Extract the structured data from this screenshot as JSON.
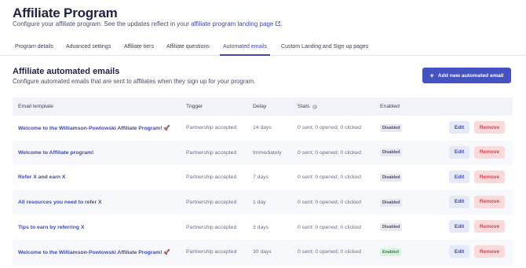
{
  "header": {
    "title": "Affiliate Program",
    "subtitle_prefix": "Configure your affiliate program. See the updates reflect in your ",
    "subtitle_link": "affiliate program landing page",
    "subtitle_suffix": "."
  },
  "tabs": [
    {
      "label": "Program details",
      "active": false
    },
    {
      "label": "Advanced settings",
      "active": false
    },
    {
      "label": "Affiliate tiers",
      "active": false
    },
    {
      "label": "Affiliate questions",
      "active": false
    },
    {
      "label": "Automated emails",
      "active": true
    },
    {
      "label": "Custom Landing and Sign up pages",
      "active": false
    }
  ],
  "section": {
    "title": "Affiliate automated emails",
    "subtitle": "Configure automated emails that are sent to affiliates when they sign up for your program.",
    "add_button_label": "Add new automated email"
  },
  "table": {
    "columns": {
      "template": "Email template",
      "trigger": "Trigger",
      "delay": "Delay",
      "stats": "Stats",
      "enabled": "Enabled"
    },
    "rows": [
      {
        "template": "Welcome to the Williamson-Powlowski Affiliate Program! 🚀",
        "trigger": "Partnership accepted",
        "delay": "14 days",
        "stats": "0 sent; 0 opened; 0 clicked",
        "status": "Disabled"
      },
      {
        "template": "Welcome to Affiliate program!",
        "trigger": "Partnership accepted",
        "delay": "Immediately",
        "stats": "0 sent; 0 opened; 0 clicked",
        "status": "Disabled"
      },
      {
        "template": "Refer X and earn X",
        "trigger": "Partnership accepted",
        "delay": "7 days",
        "stats": "0 sent; 0 opened; 0 clicked",
        "status": "Disabled"
      },
      {
        "template": "All resources you need to refer X",
        "trigger": "Partnership accepted",
        "delay": "1 day",
        "stats": "0 sent; 0 opened; 0 clicked",
        "status": "Disabled"
      },
      {
        "template": "Tips to earn by referring X",
        "trigger": "Partnership accepted",
        "delay": "3 days",
        "stats": "0 sent; 0 opened; 0 clicked",
        "status": "Disabled"
      },
      {
        "template": "Welcome to the Williamson-Powlowski Affiliate Program! 🚀",
        "trigger": "Partnership accepted",
        "delay": "30 days",
        "stats": "0 sent; 0 opened; 0 clicked",
        "status": "Enabled"
      }
    ],
    "edit_label": "Edit",
    "remove_label": "Remove"
  },
  "colors": {
    "accent": "#4552c1",
    "link": "#3e4bb0",
    "remove_bg": "#fbdadc",
    "remove_text": "#d6434f",
    "enabled_bg": "#d8f2df",
    "enabled_text": "#2d8a4a"
  }
}
